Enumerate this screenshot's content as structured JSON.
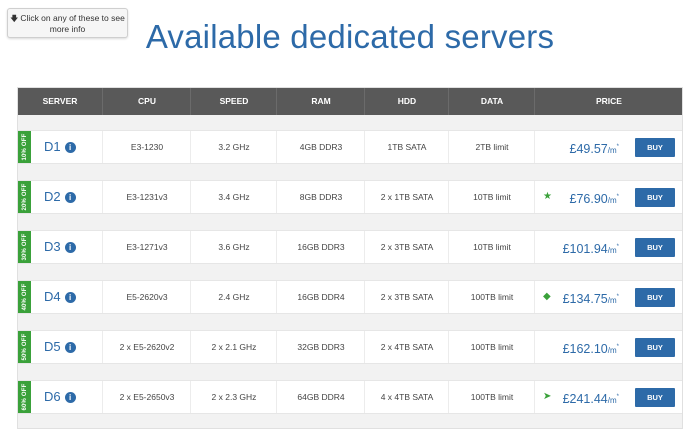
{
  "tooltip": {
    "text": "Click on any of these to see more info",
    "icon": "arrow-down-icon"
  },
  "title": "Available dedicated servers",
  "headers": [
    "SERVER",
    "CPU",
    "SPEED",
    "RAM",
    "HDD",
    "DATA",
    "PRICE"
  ],
  "rows": [
    {
      "badge": "10% OFF",
      "server": "D1",
      "cpu": "E3-1230",
      "speed": "3.2 GHz",
      "ram": "4GB DDR3",
      "hdd": "1TB SATA",
      "data": "2TB limit",
      "price": "£49.57",
      "unit": "/m",
      "sup": "*",
      "icon": "",
      "buy": "BUY"
    },
    {
      "badge": "20% OFF",
      "server": "D2",
      "cpu": "E3-1231v3",
      "speed": "3.4 GHz",
      "ram": "8GB DDR3",
      "hdd": "2 x 1TB SATA",
      "data": "10TB limit",
      "price": "£76.90",
      "unit": "/m",
      "sup": "*",
      "icon": "star-icon",
      "buy": "BUY"
    },
    {
      "badge": "30% OFF",
      "server": "D3",
      "cpu": "E3-1271v3",
      "speed": "3.6 GHz",
      "ram": "16GB DDR3",
      "hdd": "2 x 3TB SATA",
      "data": "10TB limit",
      "price": "£101.94",
      "unit": "/m",
      "sup": "*",
      "icon": "",
      "buy": "BUY"
    },
    {
      "badge": "40% OFF",
      "server": "D4",
      "cpu": "E5-2620v3",
      "speed": "2.4 GHz",
      "ram": "16GB DDR4",
      "hdd": "2 x 3TB SATA",
      "data": "100TB limit",
      "price": "£134.75",
      "unit": "/m",
      "sup": "*",
      "icon": "tag-icon",
      "buy": "BUY"
    },
    {
      "badge": "50% OFF",
      "server": "D5",
      "cpu": "2 x E5-2620v2",
      "speed": "2 x 2.1 GHz",
      "ram": "32GB DDR3",
      "hdd": "2 x 4TB SATA",
      "data": "100TB limit",
      "price": "£162.10",
      "unit": "/m",
      "sup": "*",
      "icon": "",
      "buy": "BUY"
    },
    {
      "badge": "60% OFF",
      "server": "D6",
      "cpu": "2 x E5-2650v3",
      "speed": "2 x 2.3 GHz",
      "ram": "64GB DDR4",
      "hdd": "4 x 4TB SATA",
      "data": "100TB limit",
      "price": "£241.44",
      "unit": "/m",
      "sup": "*",
      "icon": "rocket-icon",
      "buy": "BUY"
    }
  ],
  "colors": {
    "accent": "#2d6aa8",
    "badge": "#3aa13a",
    "header": "#595959"
  }
}
